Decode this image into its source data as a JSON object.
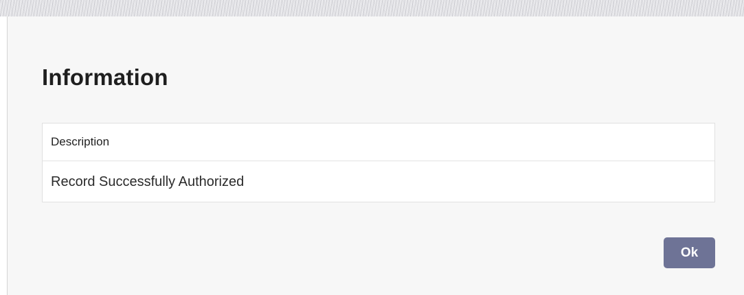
{
  "dialog": {
    "title": "Information",
    "table": {
      "header": "Description",
      "rows": [
        "Record Successfully Authorized"
      ]
    },
    "ok_label": "Ok"
  },
  "colors": {
    "dialog_background": "#f7f7f7",
    "ok_button": "#6e7396"
  }
}
